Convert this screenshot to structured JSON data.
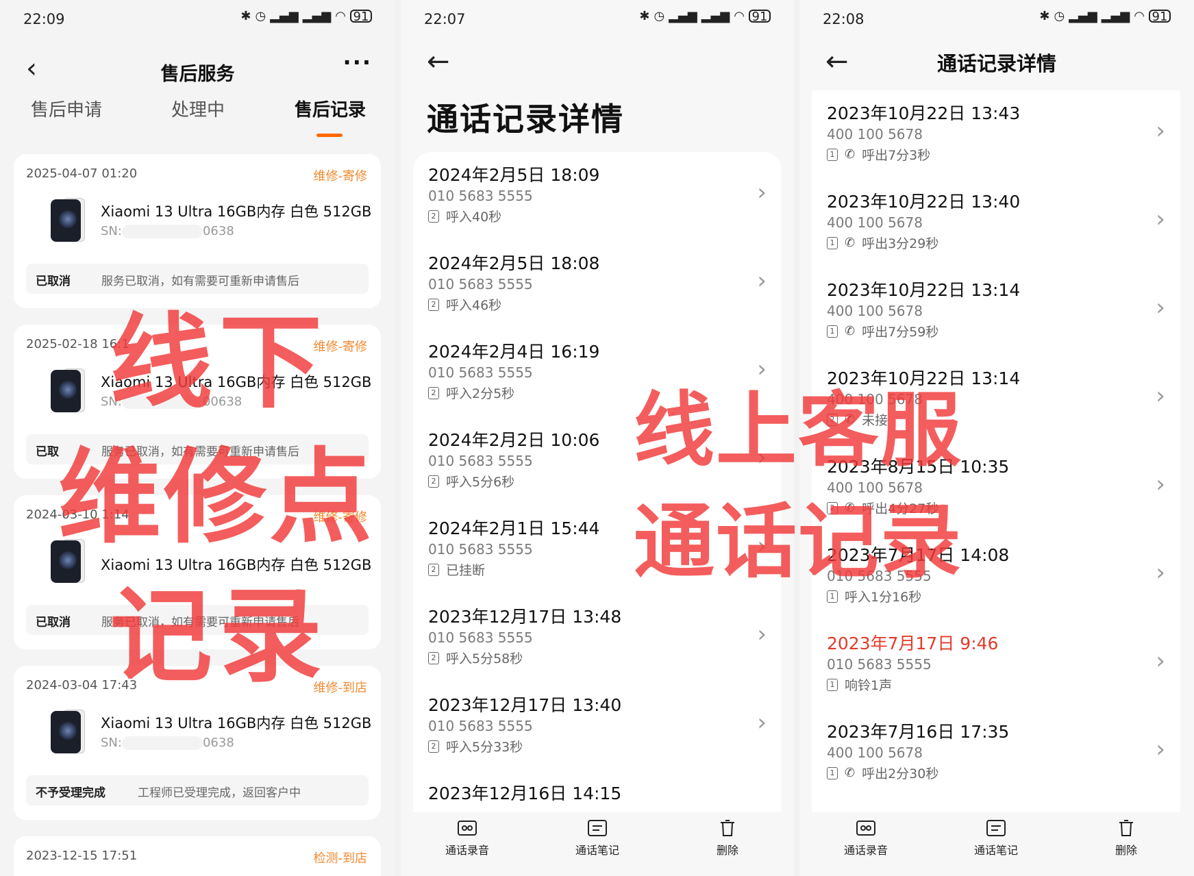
{
  "left_screen": {
    "status": {
      "time": "22:09",
      "battery": "91"
    },
    "title": "售后服务",
    "tabs": [
      "售后申请",
      "处理中",
      "售后记录"
    ],
    "records": [
      {
        "date": "2025-04-07 01:20",
        "service": "维修-寄修",
        "product": "Xiaomi 13 Ultra 16GB内存 白色 512GB",
        "sn_label": "SN:",
        "sn_suffix": "0638",
        "status": "已取消",
        "desc": "服务已取消，如有需要可重新申请售后"
      },
      {
        "date": "2025-02-18 16:1",
        "service": "维修-寄修",
        "product": "Xiaomi 13 Ultra 16GB内存 白色 512GB",
        "sn_label": "SN:",
        "sn_suffix": "00638",
        "status": "已取",
        "desc": "服务已取消，如有需要可重新申请售后"
      },
      {
        "date": "2024-03-10 1:14",
        "service": "维修-寄修",
        "product": "Xiaomi 13 Ultra 16GB内存 白色 512GB",
        "sn_label": "",
        "sn_suffix": "",
        "status": "已取消",
        "desc": "服务已取消，如有需要可重新申请售后"
      },
      {
        "date": "2024-03-04 17:43",
        "service": "维修-到店",
        "product": "Xiaomi 13 Ultra 16GB内存 白色 512GB",
        "sn_label": "SN:",
        "sn_suffix": "0638",
        "status": "不予受理完成",
        "desc": "工程师已受理完成，返回客户中"
      },
      {
        "date": "2023-12-15 17:51",
        "service": "检测-到店"
      }
    ]
  },
  "middle_screen": {
    "status": {
      "time": "22:07",
      "battery": "91"
    },
    "title": "通话记录详情",
    "calls": [
      {
        "datetime": "2024年2月5日 18:09",
        "number": "010 5683 5555",
        "sim": "2",
        "detail": "呼入40秒"
      },
      {
        "datetime": "2024年2月5日 18:08",
        "number": "010 5683 5555",
        "sim": "2",
        "detail": "呼入46秒"
      },
      {
        "datetime": "2024年2月4日 16:19",
        "number": "010 5683 5555",
        "sim": "2",
        "detail": "呼入2分5秒"
      },
      {
        "datetime": "2024年2月2日 10:06",
        "number": "010 5683 5555",
        "sim": "2",
        "detail": "呼入5分6秒"
      },
      {
        "datetime": "2024年2月1日 15:44",
        "number": "010 5683 5555",
        "sim": "2",
        "detail": "已挂断"
      },
      {
        "datetime": "2023年12月17日 13:48",
        "number": "010 5683 5555",
        "sim": "2",
        "detail": "呼入5分58秒"
      },
      {
        "datetime": "2023年12月17日 13:40",
        "number": "010 5683 5555",
        "sim": "2",
        "detail": "呼入5分33秒"
      },
      {
        "datetime": "2023年12月16日 14:15"
      }
    ],
    "bottom": [
      "通话录音",
      "通话笔记",
      "删除"
    ]
  },
  "right_screen": {
    "status": {
      "time": "22:08",
      "battery": "91"
    },
    "title": "通话记录详情",
    "calls": [
      {
        "datetime": "2023年10月22日 13:43",
        "number": "400 100 5678",
        "sim": "1",
        "detail": "呼出7分3秒",
        "outgoing": true
      },
      {
        "datetime": "2023年10月22日 13:40",
        "number": "400 100 5678",
        "sim": "1",
        "detail": "呼出3分29秒",
        "outgoing": true
      },
      {
        "datetime": "2023年10月22日 13:14",
        "number": "400 100 5678",
        "sim": "1",
        "detail": "呼出7分59秒",
        "outgoing": true
      },
      {
        "datetime": "2023年10月22日 13:14",
        "number": "400 100 5678",
        "sim": "2",
        "detail": "未接",
        "outgoing": true
      },
      {
        "datetime": "2023年8月15日 10:35",
        "number": "400 100 5678",
        "sim": "2",
        "detail": "呼出4分27秒",
        "outgoing": true
      },
      {
        "datetime": "2023年7月17日 14:08",
        "number": "010 5683 5555",
        "sim": "1",
        "detail": "呼入1分16秒"
      },
      {
        "datetime": "2023年7月17日 9:46",
        "number": "010 5683 5555",
        "sim": "1",
        "detail": "响铃1声",
        "missed": true
      },
      {
        "datetime": "2023年7月16日 17:35",
        "number": "400 100 5678",
        "sim": "1",
        "detail": "呼出2分30秒",
        "outgoing": true
      }
    ],
    "bottom": [
      "通话录音",
      "通话笔记",
      "删除"
    ]
  },
  "overlays": {
    "offline_line1": "线下",
    "offline_line2": "维修点",
    "offline_line3": "记录",
    "online_line1": "线上客服",
    "online_line2": "通话记录"
  },
  "colors": {
    "accent_orange": "#ff6a00",
    "service_tag": "#f28a2f",
    "missed_call": "#e23b2b",
    "overlay_red": "#f23a3a"
  }
}
